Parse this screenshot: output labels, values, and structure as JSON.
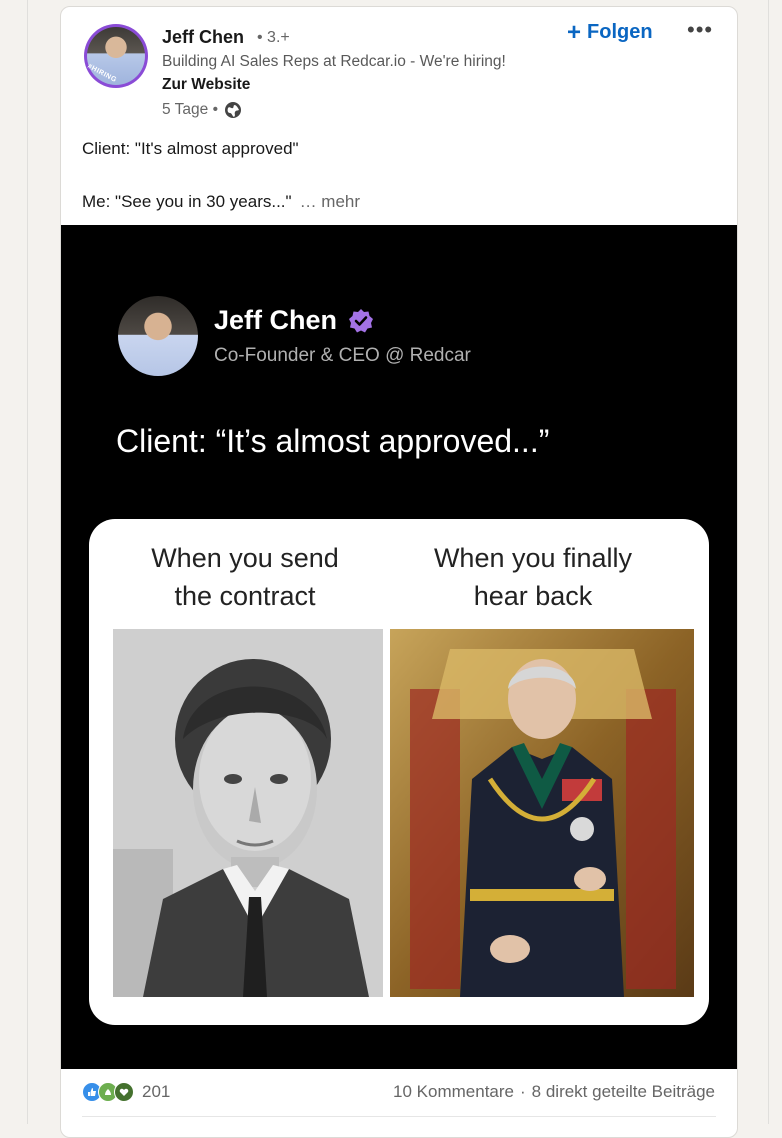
{
  "post": {
    "author_name": "Jeff Chen",
    "connection_degree": "• 3.+",
    "headline": "Building AI Sales Reps at Redcar.io - We're hiring!",
    "website_link": "Zur Website",
    "timestamp": "5 Tage •",
    "follow_label": "Folgen",
    "more_label": "•••",
    "avatar_badge": "#HIRING",
    "text_line1": "Client: \"It's almost approved\"",
    "text_line2": "Me: \"See you in 30 years...\"",
    "see_more": "… mehr"
  },
  "media": {
    "name": "Jeff Chen",
    "title": "Co-Founder & CEO @ Redcar",
    "quote": "Client: “It’s almost approved...”",
    "caption_left_1": "When you send",
    "caption_left_2": "the contract",
    "caption_right_1": "When you finally",
    "caption_right_2": "hear back"
  },
  "social": {
    "reaction_count": "201",
    "comments": "10 Kommentare",
    "separator": "·",
    "shares": "8 direkt geteilte Beiträge"
  },
  "colors": {
    "accent": "#0a66c2",
    "verified": "#a372e6",
    "hiring_ring": "#8a4bd6"
  }
}
